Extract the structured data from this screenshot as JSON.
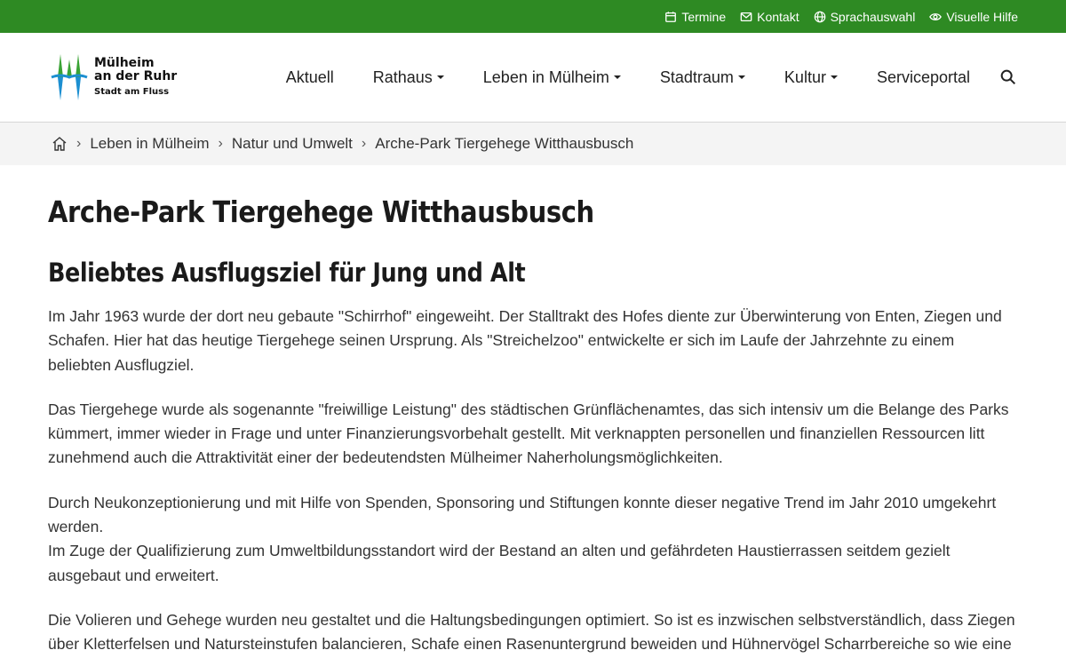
{
  "topbar": {
    "items": [
      {
        "label": "Termine",
        "icon": "calendar-icon"
      },
      {
        "label": "Kontakt",
        "icon": "mail-icon"
      },
      {
        "label": "Sprachauswahl",
        "icon": "globe-icon"
      },
      {
        "label": "Visuelle Hilfe",
        "icon": "eye-icon"
      }
    ],
    "color": "#2e8a23"
  },
  "logo": {
    "line1": "Mülheim",
    "line2": "an der Ruhr",
    "line3": "Stadt am Fluss"
  },
  "nav": {
    "items": [
      {
        "label": "Aktuell",
        "dropdown": false
      },
      {
        "label": "Rathaus",
        "dropdown": true
      },
      {
        "label": "Leben in Mülheim",
        "dropdown": true
      },
      {
        "label": "Stadtraum",
        "dropdown": true
      },
      {
        "label": "Kultur",
        "dropdown": true
      },
      {
        "label": "Serviceportal",
        "dropdown": false
      }
    ],
    "search_icon": "search-icon"
  },
  "breadcrumb": {
    "home_icon": "home-icon",
    "items": [
      "Leben in Mülheim",
      "Natur und Umwelt",
      "Arche-Park Tiergehege Witthausbusch"
    ]
  },
  "page": {
    "title": "Arche-Park Tiergehege Witthausbusch",
    "subtitle": "Beliebtes Ausflugsziel für Jung und Alt",
    "paragraphs": [
      [
        "Im Jahr 1963 wurde der dort neu gebaute \"Schirrhof\" eingeweiht. Der Stalltrakt des Hofes diente zur Überwinterung von Enten, Ziegen und Schafen. Hier hat das heutige Tiergehege seinen Ursprung. Als \"Streichelzoo\" entwickelte er sich im Laufe der Jahrzehnte zu einem beliebten Ausflugziel."
      ],
      [
        "Das Tiergehege wurde als sogenannte \"freiwillige Leistung\" des städtischen Grünflächenamtes, das sich intensiv um die Belange des Parks kümmert, immer wieder in Frage und unter Finanzierungsvorbehalt gestellt. Mit verknappten personellen und finanziellen Ressourcen litt zunehmend auch die Attraktivität einer der bedeutendsten Mülheimer Naherholungsmöglichkeiten."
      ],
      [
        "Durch Neukonzeptionierung und mit Hilfe von Spenden, Sponsoring und Stiftungen konnte dieser negative Trend im Jahr 2010 umgekehrt werden.",
        "Im Zuge der Qualifizierung zum Umweltbildungsstandort wird der Bestand an alten und gefährdeten Haustierrassen seitdem gezielt ausgebaut und erweitert."
      ],
      [
        "Die Volieren und Gehege wurden neu gestaltet und die Haltungsbedingungen optimiert. So ist es inzwischen selbstverständlich, dass Ziegen über Kletterfelsen und Natursteinstufen balancieren, Schafe einen Rasenuntergrund beweiden und Hühnervögel Scharrbereiche so wie eine"
      ]
    ]
  }
}
